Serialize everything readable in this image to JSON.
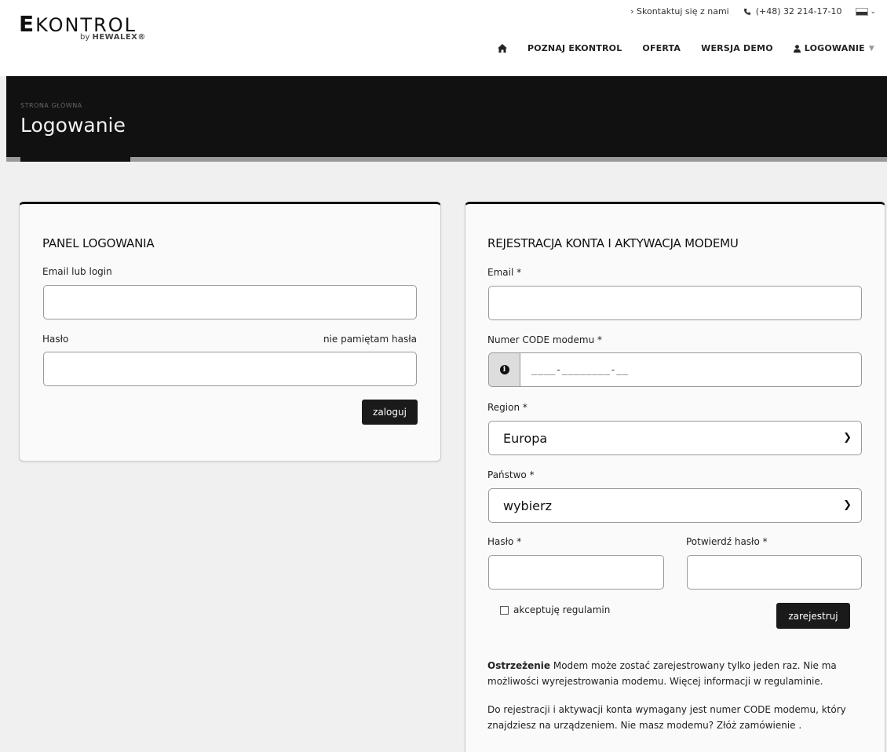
{
  "header": {
    "logo_text": "EKONTROL",
    "logo_first": "E",
    "logo_rest": "KONTROL",
    "logo_by": "by",
    "logo_brand": "HEWALEX®",
    "contact_link": "› Skontaktuj się z nami",
    "phone": "(+48) 32 214-17-10",
    "phone_icon": "phone-icon",
    "language_flag": "flag-icon"
  },
  "nav": {
    "home_icon": "home-icon",
    "items": [
      {
        "label": "POZNAJ EKONTROL"
      },
      {
        "label": "OFERTA"
      },
      {
        "label": "WERSJA DEMO"
      }
    ],
    "login_label": "LOGOWANIE",
    "login_icon": "user-icon"
  },
  "page": {
    "breadcrumb": "STRONA GŁÓWNA",
    "title": "Logowanie"
  },
  "login_panel": {
    "heading": "PANEL LOGOWANIA",
    "email_label": "Email lub login",
    "email_value": "",
    "password_label": "Hasło",
    "password_value": "",
    "forgot_link": "nie pamiętam hasła",
    "submit_label": "zaloguj"
  },
  "register_panel": {
    "heading": "REJESTRACJA KONTA I AKTYWACJA MODEMU",
    "email_label": "Email *",
    "email_value": "",
    "code_label": "Numer CODE modemu *",
    "code_mask": "____-________-__",
    "code_icon": "info-icon",
    "region_label": "Region *",
    "region_value": "Europa",
    "country_label": "Państwo *",
    "country_value": "wybierz",
    "password_label": "Hasło *",
    "password_value": "",
    "confirm_label": "Potwierdź hasło *",
    "confirm_value": "",
    "terms_label": "akceptuję regulamin",
    "terms_checked": false,
    "submit_label": "zarejestruj",
    "warning_bold": "Ostrzeżenie",
    "warning_text": " Modem może zostać zarejestrowany tylko jeden raz. Nie ma możliwości wyrejestrowania modemu. Więcej informacji w regulaminie.",
    "info_text": "Do rejestracji i aktywacji konta wymagany jest numer CODE modemu, który znajdziesz na urządzeniem. Nie masz modemu? Złóż zamówienie ."
  },
  "colors": {
    "title_band": "#111111",
    "button": "#1a1a1a",
    "background": "#f0f0f0"
  }
}
